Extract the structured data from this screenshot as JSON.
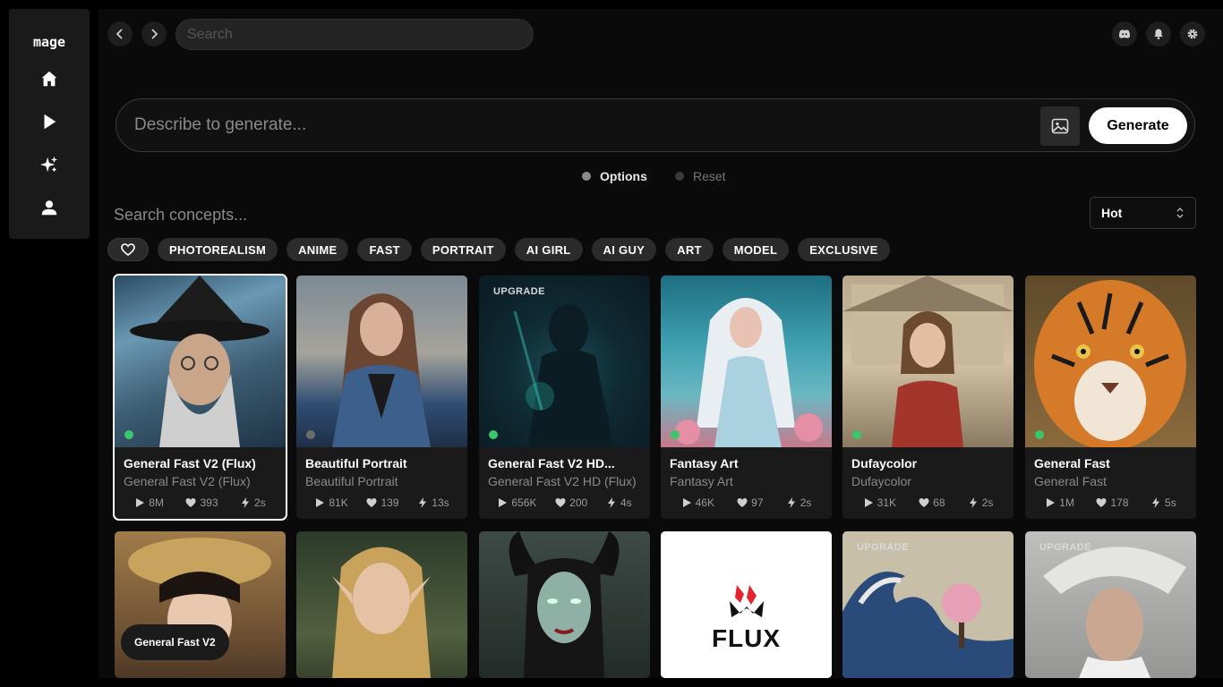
{
  "app": {
    "logo": "mage"
  },
  "sidebar": {
    "items": [
      {
        "name": "home",
        "icon": "home-icon"
      },
      {
        "name": "play",
        "icon": "play-icon"
      },
      {
        "name": "sparkle",
        "icon": "sparkle-icon"
      },
      {
        "name": "profile",
        "icon": "user-icon"
      }
    ]
  },
  "topbar": {
    "search_placeholder": "Search",
    "icons": [
      "discord-icon",
      "bell-icon",
      "gear-icon"
    ]
  },
  "prompt": {
    "placeholder": "Describe to generate...",
    "generate_label": "Generate"
  },
  "options": {
    "options_label": "Options",
    "reset_label": "Reset"
  },
  "concepts": {
    "search_placeholder": "Search concepts...",
    "sort_value": "Hot",
    "tags": [
      "PHOTOREALISM",
      "ANIME",
      "FAST",
      "PORTRAIT",
      "AI GIRL",
      "AI GUY",
      "ART",
      "MODEL",
      "EXCLUSIVE"
    ]
  },
  "cards_row1": [
    {
      "title": "General Fast V2 (Flux)",
      "subtitle": "General Fast V2 (Flux)",
      "uses": "8M",
      "likes": "393",
      "speed": "2s",
      "status": "green",
      "badge": "",
      "selected": true
    },
    {
      "title": "Beautiful Portrait",
      "subtitle": "Beautiful Portrait",
      "uses": "81K",
      "likes": "139",
      "speed": "13s",
      "status": "gray",
      "badge": "",
      "selected": false
    },
    {
      "title": "General Fast V2 HD...",
      "subtitle": "General Fast V2 HD (Flux)",
      "uses": "656K",
      "likes": "200",
      "speed": "4s",
      "status": "green",
      "badge": "UPGRADE",
      "selected": false
    },
    {
      "title": "Fantasy Art",
      "subtitle": "Fantasy Art",
      "uses": "46K",
      "likes": "97",
      "speed": "2s",
      "status": "green",
      "badge": "",
      "selected": false
    },
    {
      "title": "Dufaycolor",
      "subtitle": "Dufaycolor",
      "uses": "31K",
      "likes": "68",
      "speed": "2s",
      "status": "green",
      "badge": "",
      "selected": false
    },
    {
      "title": "General Fast",
      "subtitle": "General Fast",
      "uses": "1M",
      "likes": "178",
      "speed": "5s",
      "status": "green",
      "badge": "",
      "selected": false
    }
  ],
  "cards_row2": [
    {
      "badge": ""
    },
    {
      "badge": ""
    },
    {
      "badge": ""
    },
    {
      "badge": "",
      "flux_text": "FLUX"
    },
    {
      "badge": "UPGRADE"
    },
    {
      "badge": "UPGRADE"
    }
  ],
  "tooltip": "General Fast V2",
  "colors": {
    "green": "#3ec46d",
    "gray": "#6b6b6b",
    "accent": "#ffffff",
    "flux_red": "#e3262d"
  }
}
